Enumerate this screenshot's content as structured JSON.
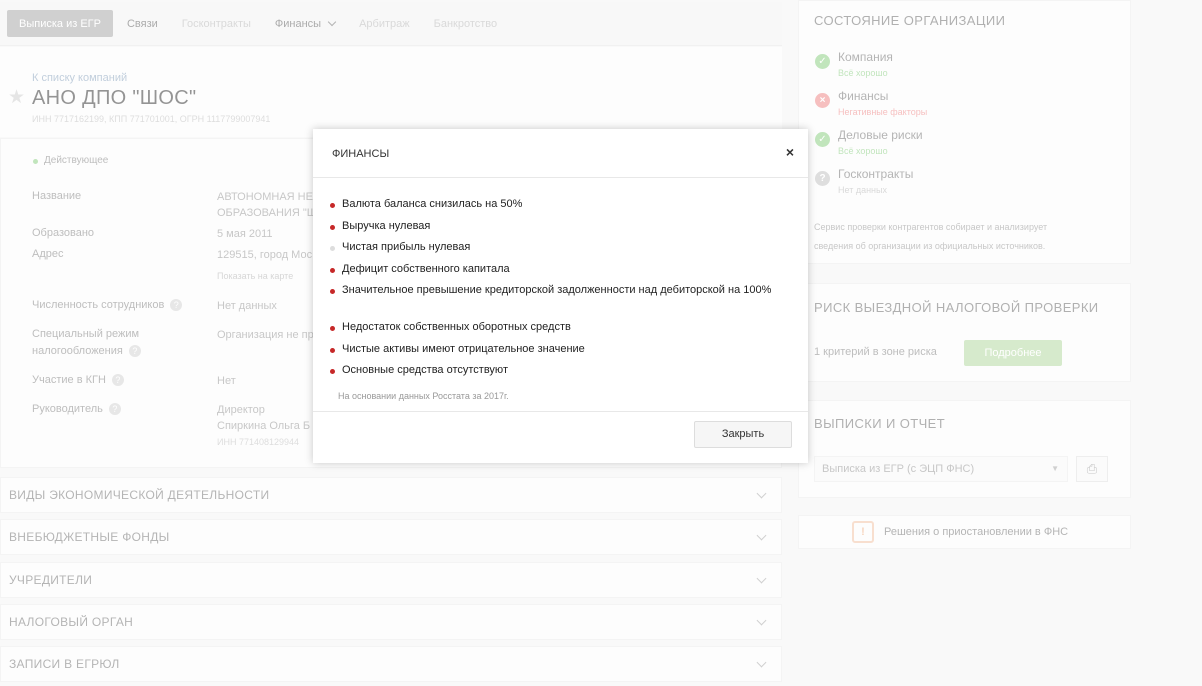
{
  "tabs": {
    "egr": "Выписка из ЕГР",
    "links": "Связи",
    "contracts": "Госконтракты",
    "finance": "Финансы",
    "arbitration": "Арбитраж",
    "bankruptcy": "Банкротство"
  },
  "company": {
    "back_link": "К списку компаний",
    "name": "АНО ДПО \"ШОС\"",
    "ids": "ИНН 7717162199, КПП 771701001, ОГРН 1117799007941",
    "status": "Действующее"
  },
  "details": {
    "name_label": "Название",
    "name_line1": "АВТОНОМНАЯ НЕ",
    "name_line2": "ОБРАЗОВАНИЯ \"Ш",
    "founded_label": "Образовано",
    "founded_value": "5 мая 2011",
    "address_label": "Адрес",
    "address_value": "129515, город Мос",
    "map_link": "Показать на карте",
    "employees_label": "Численность сотрудников",
    "employees_value": "Нет данных",
    "tax_regime_label_1": "Специальный режим",
    "tax_regime_label_2": "налогообложения",
    "tax_regime_value": "Организация не пр",
    "kgn_label": "Участие в КГН",
    "kgn_value": "Нет",
    "head_label": "Руководитель",
    "head_role": "Директор",
    "head_name": "Спиркина Ольга Б",
    "head_inn": "ИНН 771408129944"
  },
  "accordions": [
    "ВИДЫ ЭКОНОМИЧЕСКОЙ ДЕЯТЕЛЬНОСТИ",
    "ВНЕБЮДЖЕТНЫЕ ФОНДЫ",
    "УЧРЕДИТЕЛИ",
    "НАЛОГОВЫЙ ОРГАН",
    "ЗАПИСИ В ЕГРЮЛ"
  ],
  "state_panel": {
    "title": "СОСТОЯНИЕ ОРГАНИЗАЦИИ",
    "items": [
      {
        "name": "Компания",
        "status": "Всё хорошо"
      },
      {
        "name": "Финансы",
        "status": "Негативные факторы"
      },
      {
        "name": "Деловые риски",
        "status": "Всё хорошо"
      },
      {
        "name": "Госконтракты",
        "status": "Нет данных"
      }
    ],
    "colors": {
      "ok": "#8ecf86",
      "bad": "#ee8b8b",
      "none": "#c4c4c4"
    },
    "description_1": "Сервис проверки контрагентов собирает и анализирует",
    "description_2": "сведения об организации из официальных источников."
  },
  "risk_panel": {
    "title": "РИСК ВЫЕЗДНОЙ НАЛОГОВОЙ ПРОВЕРКИ",
    "text": "1 критерий в зоне риска",
    "button": "Подробнее"
  },
  "reports_panel": {
    "title": "ВЫПИСКИ И ОТЧЕТ",
    "select_value": "Выписка из ЕГР (с ЭЦП ФНС)",
    "print_icon": "printer-icon"
  },
  "decisions": {
    "text": "Решения о приостановлении в ФНС",
    "icon": "document-icon"
  },
  "modal": {
    "title": "ФИНАНСЫ",
    "items": [
      {
        "text": "Валюта баланса снизилась на 50%",
        "severity": "bad"
      },
      {
        "text": "Выручка нулевая",
        "severity": "bad"
      },
      {
        "text": "Чистая прибыль нулевая",
        "severity": "neutral"
      },
      {
        "text": "Дефицит собственного капитала",
        "severity": "bad"
      },
      {
        "text": "Значительное превышение кредиторской задолженности над дебиторской на 100%",
        "severity": "bad"
      },
      {
        "text": "Недостаток собственных оборотных средств",
        "severity": "bad"
      },
      {
        "text": "Чистые активы имеют отрицательное значение",
        "severity": "bad"
      },
      {
        "text": "Основные средства отсутствуют",
        "severity": "bad"
      }
    ],
    "severity_colors": {
      "bad": "#c62828",
      "neutral": "#dddddd"
    },
    "source": "На основании данных Росстата за 2017г.",
    "close_button": "Закрыть"
  }
}
